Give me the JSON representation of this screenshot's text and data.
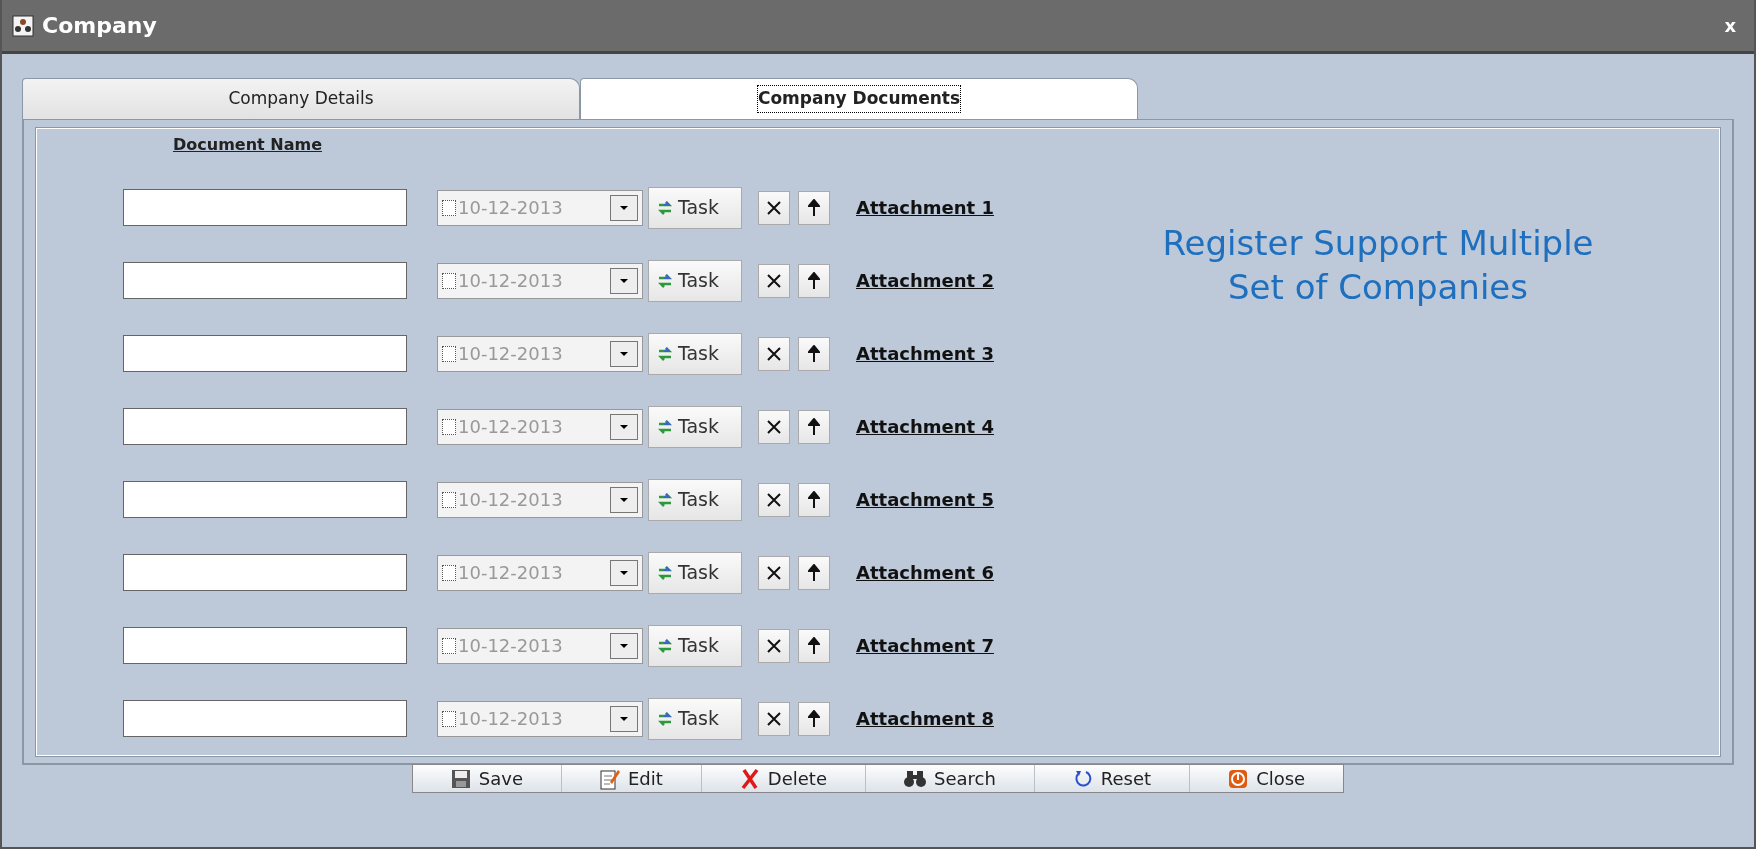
{
  "window": {
    "title": "Company",
    "close": "x"
  },
  "tabs": [
    {
      "label": "Company Details",
      "selected": false
    },
    {
      "label": "Company Documents",
      "selected": true
    }
  ],
  "documents": {
    "column_header": "Document Name",
    "rows": [
      {
        "name": "",
        "date": "10-12-2013",
        "checked": false,
        "task": "Task",
        "attachment": "Attachment 1"
      },
      {
        "name": "",
        "date": "10-12-2013",
        "checked": false,
        "task": "Task",
        "attachment": "Attachment 2"
      },
      {
        "name": "",
        "date": "10-12-2013",
        "checked": false,
        "task": "Task",
        "attachment": "Attachment 3"
      },
      {
        "name": "",
        "date": "10-12-2013",
        "checked": false,
        "task": "Task",
        "attachment": "Attachment 4"
      },
      {
        "name": "",
        "date": "10-12-2013",
        "checked": false,
        "task": "Task",
        "attachment": "Attachment 5"
      },
      {
        "name": "",
        "date": "10-12-2013",
        "checked": false,
        "task": "Task",
        "attachment": "Attachment 6"
      },
      {
        "name": "",
        "date": "10-12-2013",
        "checked": false,
        "task": "Task",
        "attachment": "Attachment 7"
      },
      {
        "name": "",
        "date": "10-12-2013",
        "checked": false,
        "task": "Task",
        "attachment": "Attachment 8"
      }
    ]
  },
  "caption": [
    "Register Support Multiple",
    "Set of Companies"
  ],
  "toolbar": [
    {
      "kind": "save",
      "label": "Save"
    },
    {
      "kind": "edit",
      "label": "Edit"
    },
    {
      "kind": "delete",
      "label": "Delete"
    },
    {
      "kind": "search",
      "label": "Search"
    },
    {
      "kind": "reset",
      "label": "Reset"
    },
    {
      "kind": "close",
      "label": "Close"
    }
  ]
}
